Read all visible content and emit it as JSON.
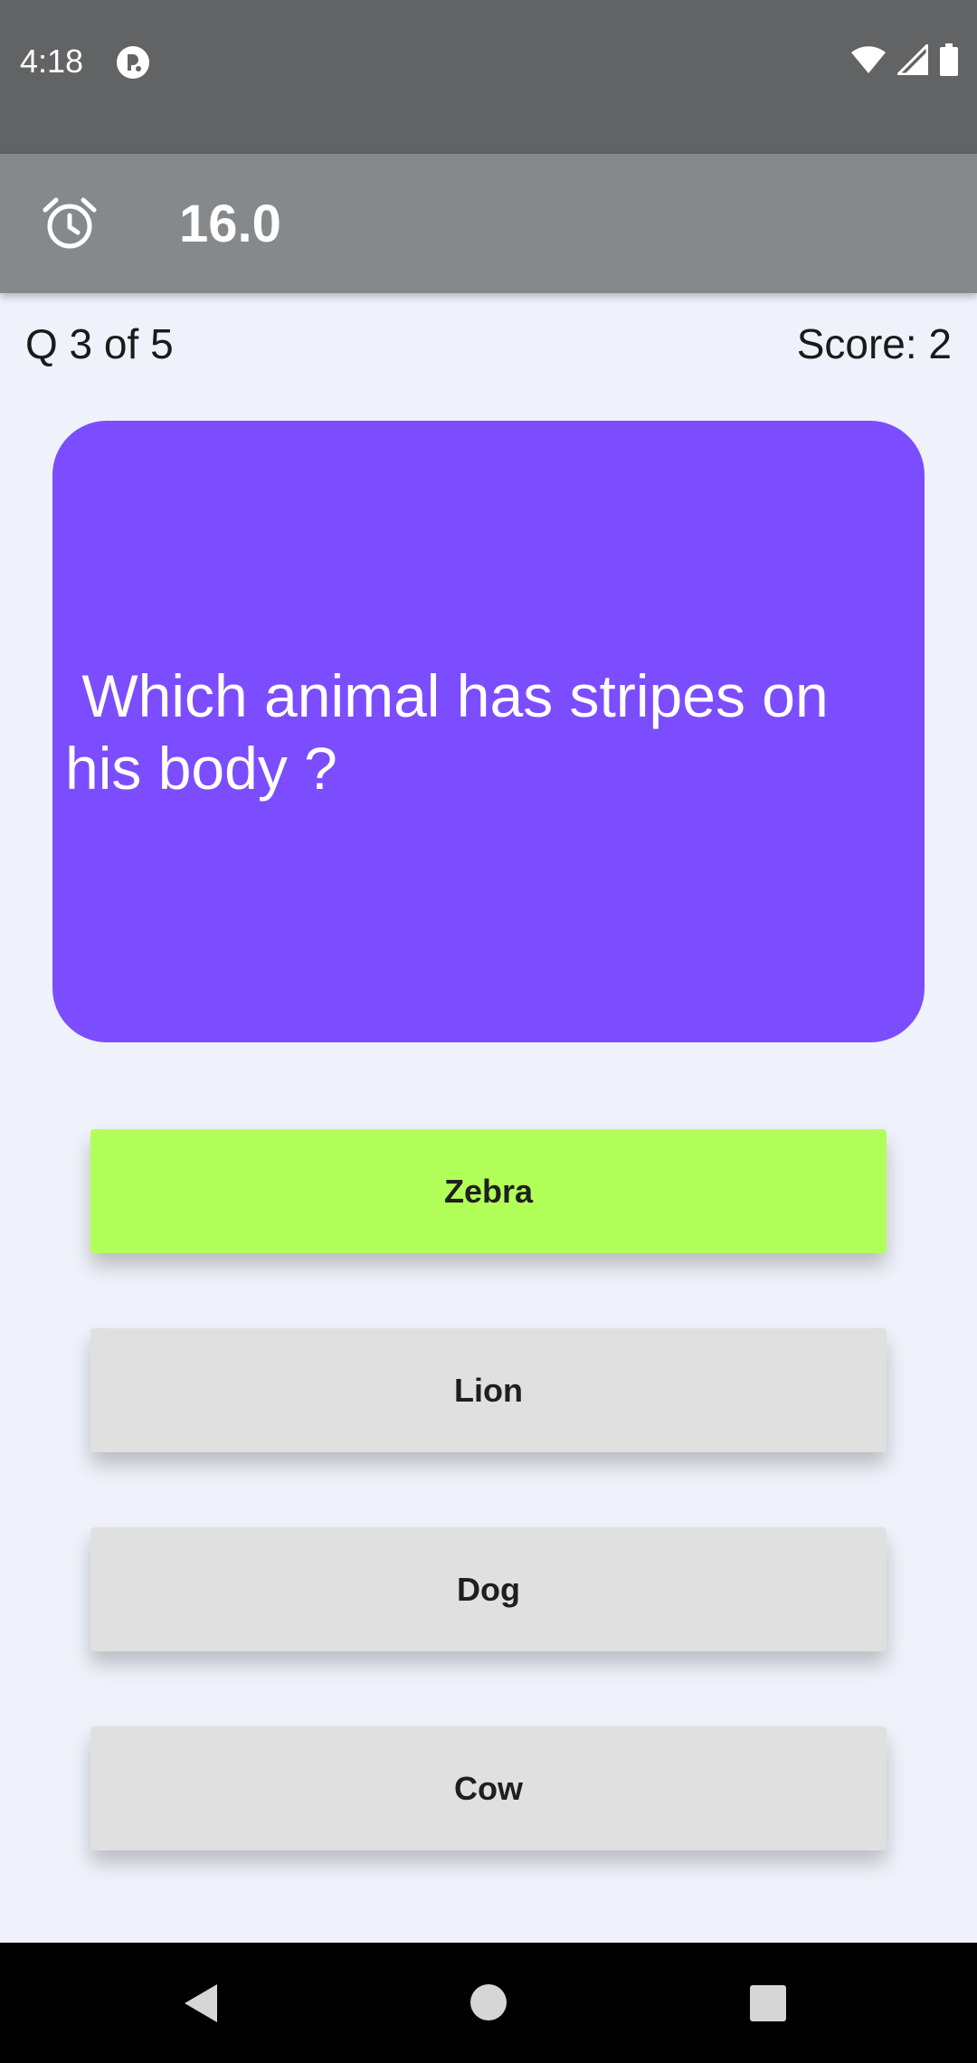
{
  "status_bar": {
    "time": "4:18",
    "icons": [
      "app-notification-icon",
      "wifi-icon",
      "signal-icon",
      "battery-icon"
    ]
  },
  "toolbar": {
    "icon": "alarm-icon",
    "timer": "16.0"
  },
  "quiz": {
    "counter": "Q 3 of 5",
    "score": "Score: 2",
    "question": " Which animal has stripes on his body ?",
    "options": [
      {
        "label": "Zebra",
        "state": "correct"
      },
      {
        "label": "Lion",
        "state": "default"
      },
      {
        "label": "Dog",
        "state": "default"
      },
      {
        "label": "Cow",
        "state": "default"
      }
    ]
  },
  "colors": {
    "status_bar": "#616365",
    "toolbar": "#86898b",
    "background": "#eff2fa",
    "question_card": "#7c4dff",
    "correct_option": "#b2ff59",
    "option_default": "#e0e0e0"
  },
  "nav_bar": {
    "icons": [
      "back-icon",
      "home-icon",
      "recents-icon"
    ]
  }
}
